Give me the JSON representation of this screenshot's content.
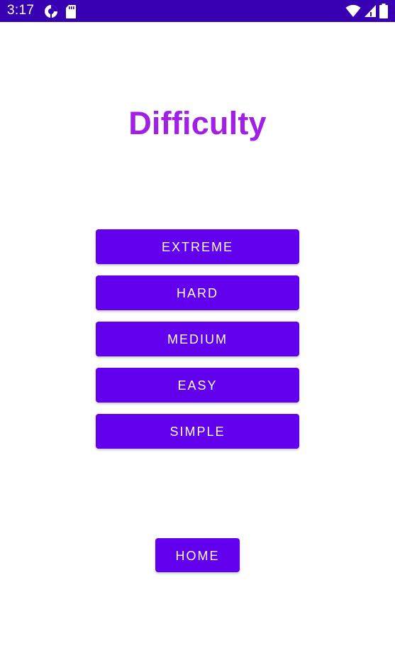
{
  "status_bar": {
    "time": "3:17",
    "background_color": "#3700b3",
    "left_icons": [
      "data-saver-icon",
      "sd-card-icon"
    ],
    "right_icons": [
      "wifi-icon",
      "cell-signal-icon",
      "battery-icon"
    ]
  },
  "page": {
    "title": "Difficulty",
    "title_color": "#a020e6"
  },
  "difficulty_buttons": [
    {
      "label": "EXTREME"
    },
    {
      "label": "HARD"
    },
    {
      "label": "MEDIUM"
    },
    {
      "label": "EASY"
    },
    {
      "label": "SIMPLE"
    }
  ],
  "home_button": {
    "label": "HOME"
  },
  "colors": {
    "button_background": "#6200ee",
    "button_text": "#ffffff"
  }
}
